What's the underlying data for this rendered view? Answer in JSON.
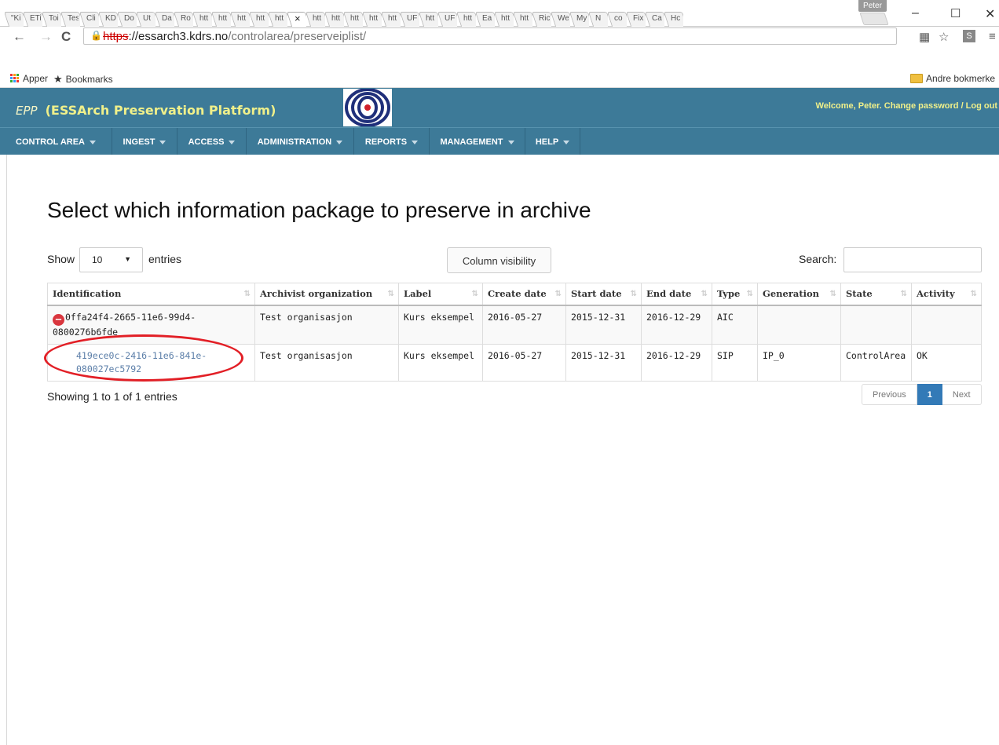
{
  "browser": {
    "tabs": [
      "\"Ki",
      "ETi",
      "Toi",
      "Tes",
      "Cli",
      "KD",
      "Do",
      "Ut",
      "Da",
      "Ro",
      "htt",
      "htt",
      "htt",
      "htt",
      "htt",
      "×",
      "htt",
      "htt",
      "htt",
      "htt",
      "htt",
      "UF",
      "htt",
      "UF",
      "htt",
      "Ea",
      "htt",
      "htt",
      "Ric",
      "We",
      "My",
      "N",
      "co",
      "Fix",
      "Ca",
      "Hc"
    ],
    "active_tab_index": 15,
    "profile_name": "Peter",
    "url_scheme": "https",
    "url_host": "://essarch3.kdrs.no",
    "url_path": "/controlarea/preserveiplist/",
    "bookmarks": {
      "apps_label": "Apper",
      "bookmarks_label": "Bookmarks",
      "other_label": "Andre bokmerke"
    }
  },
  "header": {
    "epp": "EPP",
    "brand_name": "(ESSArch Preservation Platform)",
    "welcome": "Welcome, Peter. Change password / Log out"
  },
  "menu": [
    {
      "label": "CONTROL AREA"
    },
    {
      "label": "INGEST"
    },
    {
      "label": "ACCESS"
    },
    {
      "label": "ADMINISTRATION"
    },
    {
      "label": "REPORTS"
    },
    {
      "label": "MANAGEMENT"
    },
    {
      "label": "HELP"
    }
  ],
  "main": {
    "title": "Select which information package to preserve in archive",
    "show_label": "Show",
    "page_length": "10",
    "entries_label": "entries",
    "column_visibility": "Column visibility",
    "search_label": "Search:",
    "search_value": "",
    "columns": [
      "Identification",
      "Archivist organization",
      "Label",
      "Create date",
      "Start date",
      "End date",
      "Type",
      "Generation",
      "State",
      "Activity"
    ],
    "rows": [
      {
        "identification": "0ffa24f4-2665-11e6-99d4-0800276b6fde",
        "id_line1": "0ffa24f4-2665-11e6-99d4-",
        "id_line2": "0800276b6fde",
        "organization": "Test organisasjon",
        "label": "Kurs eksempel",
        "create_date": "2016-05-27",
        "start_date": "2015-12-31",
        "end_date": "2016-12-29",
        "type": "AIC",
        "generation": "",
        "state": "",
        "activity": ""
      },
      {
        "identification": "419ece0c-2416-11e6-841e-080027ec5792",
        "id_line1": "419ece0c-2416-11e6-841e-",
        "id_line2": "080027ec5792",
        "organization": "Test organisasjon",
        "label": "Kurs eksempel",
        "create_date": "2016-05-27",
        "start_date": "2015-12-31",
        "end_date": "2016-12-29",
        "type": "SIP",
        "generation": "IP_0",
        "state": "ControlArea",
        "activity": "OK"
      }
    ],
    "info": "Showing 1 to 1 of 1 entries",
    "pagination": {
      "previous": "Previous",
      "current": "1",
      "next": "Next"
    }
  },
  "colors": {
    "header_bg": "#3d7a98",
    "brand_text": "#f0f08a",
    "link": "#5b7ea8",
    "annotation": "#e21f26",
    "pager_active": "#337ab7"
  }
}
